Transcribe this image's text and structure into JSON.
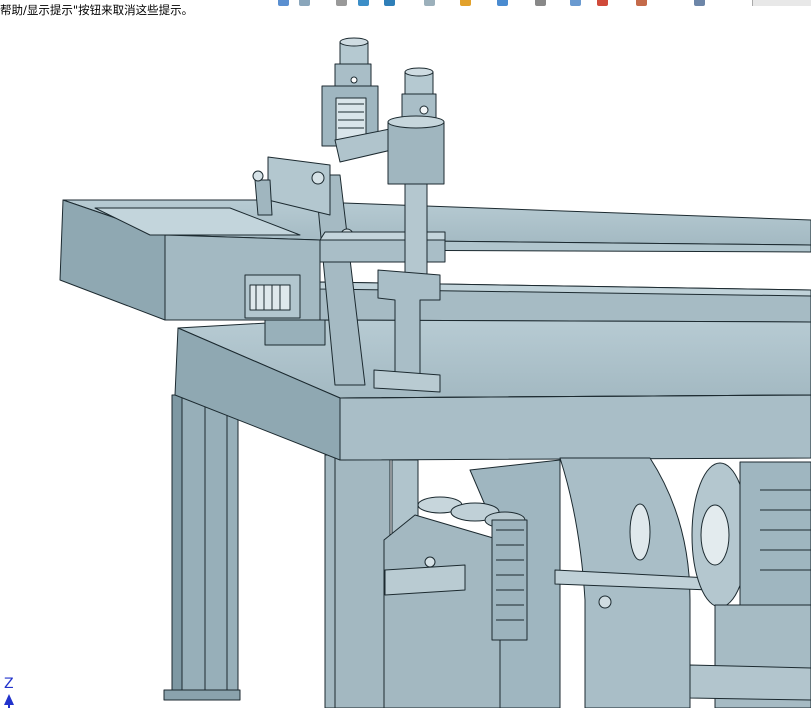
{
  "status_hint": "帮助/显示提示\"按钮来取消这些提示。",
  "triad": {
    "axis_label": "Z"
  },
  "colors": {
    "model_base": "#9fb6c0",
    "model_light": "#b9cdd5",
    "model_dark": "#6f8892",
    "edge": "#1c2a30",
    "triad": "#2233cc"
  },
  "toolbar_icons": [
    "new-file-icon",
    "cube-icon",
    "cursor-icon",
    "box-icon",
    "box-icon",
    "sphere-icon",
    "gear-icon",
    "chart-icon",
    "wrench-icon",
    "document-icon",
    "delete-icon",
    "clipboard-icon",
    "window-icon",
    "help-icon"
  ]
}
